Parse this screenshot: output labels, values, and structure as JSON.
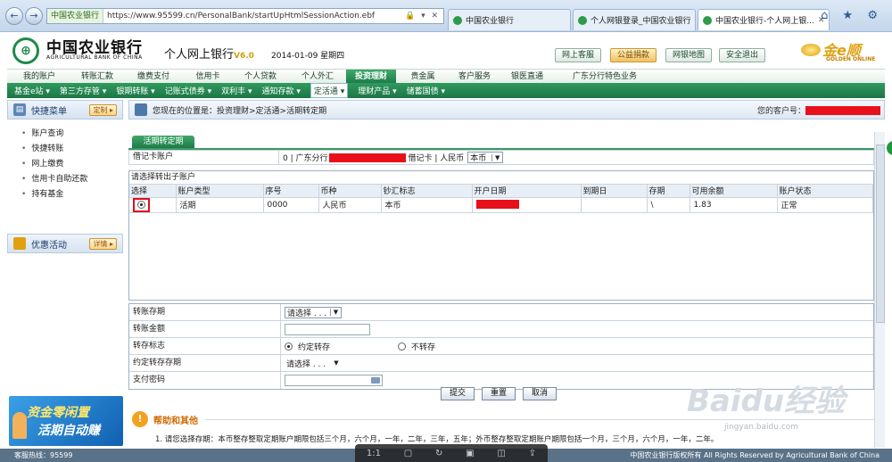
{
  "browser": {
    "site_badge": "中国农业银行",
    "url": "https://www.95599.cn/PersonalBank/startUpHtmlSessionAction.ebf",
    "addr_icons": "🔒 ▾ ✕",
    "tabs": [
      "中国农业银行",
      "个人网银登录_中国农业银行",
      "中国农业银行-个人网上银..."
    ],
    "back_icon": "←",
    "forward_icon": "→",
    "right_icons": "⌂ ★ ⚙"
  },
  "header": {
    "logo_glyph": "⊕",
    "bank_cn": "中国农业银行",
    "bank_en": "AGRICULTURAL BANK OF CHINA",
    "ebank": "个人网上银行",
    "version": "V6.0",
    "date": "2014-01-09 星期四",
    "buttons": [
      "网上客服",
      "公益捐款",
      "网银地图",
      "安全退出"
    ],
    "golden_cn": "金e顺",
    "golden_en": "GOLDEN ONLINE"
  },
  "mainnav": [
    "我的账户",
    "转账汇款",
    "缴费支付",
    "信用卡",
    "个人贷款",
    "个人外汇",
    "投资理财",
    "贵金属",
    "客户服务",
    "银医直通",
    "广东分行特色业务"
  ],
  "subnav": [
    "基金e站 ▾",
    "第三方存管 ▾",
    "银期转账 ▾",
    "记账式债券 ▾",
    "双利丰 ▾",
    "通知存款 ▾",
    "定活通 ▾",
    "理财产品 ▾",
    "储蓄国债 ▾"
  ],
  "sidebar": {
    "quick_title": "快捷菜单",
    "custom_btn": "定制 ▸",
    "items": [
      "账户查询",
      "快捷转账",
      "网上缴费",
      "信用卡自助还款",
      "持有基金"
    ],
    "promo_title": "优惠活动",
    "detail_btn": "详情 ▸",
    "banner_l1": "资金零闲置",
    "banner_l2": "活期自动赚"
  },
  "content": {
    "crumb": "您现在的位置是：投资理财>定活通>活期转定期",
    "cust_label": "您的客户号：",
    "section_tab": "活期转定期",
    "card_label": "借记卡账户",
    "card_prefix": "0 | 广东分行",
    "card_type": "借记卡 | 人民币",
    "card_currency": "本币",
    "table_title": "请选择转出子账户",
    "columns": [
      "选择",
      "账户类型",
      "序号",
      "币种",
      "钞汇标志",
      "开户日期",
      "到期日",
      "存期",
      "可用余额",
      "账户状态"
    ],
    "row": {
      "type": "活期",
      "seq": "0000",
      "currency": "人民币",
      "flag": "本币",
      "due": "",
      "term": "\\",
      "balance": "1.83",
      "status": "正常"
    },
    "form": {
      "term_label": "转账存期",
      "term_value": "请选择 . . .",
      "amount_label": "转账金额",
      "flag_label": "转存标志",
      "opt1": "约定转存",
      "opt2": "不转存",
      "agreed_label": "约定转存存期",
      "agreed_value": "请选择 . . .",
      "pwd_label": "支付密码"
    },
    "buttons": [
      "提交",
      "重置",
      "取消"
    ],
    "help_title": "帮助和其他",
    "help_text": "1. 请您选择存期：本币整存整取定期账户期限包括三个月，六个月，一年，二年，三年，五年；外币整存整取定期账户期限包括一个月，三个月，六个月，一年，二年。"
  },
  "footer": {
    "hotline": "客服热线：95599",
    "copy": "中国农业银行版权所有 All Rights Reserved by Agricultural Bank of China"
  },
  "video_toolbar": [
    "1:1",
    "▢",
    "↻",
    "▣",
    "◫",
    "⇪"
  ],
  "watermark": {
    "big": "Baidu经验",
    "small": "jingyan.baidu.com"
  },
  "colors": {
    "brand_green": "#1d7a48",
    "accent_red": "#e8101a",
    "gold": "#e0a010"
  }
}
